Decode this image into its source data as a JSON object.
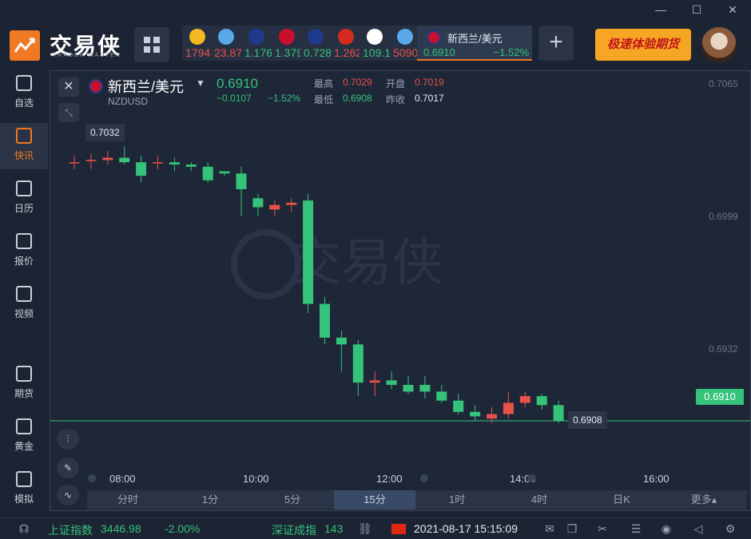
{
  "app": {
    "logo_text": "交易侠",
    "logo_sub": "TRADER MASTER",
    "window_controls": [
      "—",
      "☐",
      "✕"
    ]
  },
  "quotes": [
    {
      "icon": "gold-coin-icon",
      "value": "1794",
      "color": "#e8524a",
      "icon_color": "#f5b722"
    },
    {
      "icon": "silver-icon",
      "value": "23.87",
      "color": "#e8524a",
      "icon_color": "#5aa8e8"
    },
    {
      "icon": "eu-us-flag-icon",
      "value": "1.176",
      "color": "#35c27a",
      "icon_color": "#1f3a8a"
    },
    {
      "icon": "gb-us-flag-icon",
      "value": "1.379",
      "color": "#35c27a",
      "icon_color": "#c8102e"
    },
    {
      "icon": "au-us-flag-icon",
      "value": "0.728",
      "color": "#35c27a",
      "icon_color": "#1f3a8a"
    },
    {
      "icon": "ca-us-flag-icon",
      "value": "1.262",
      "color": "#e8524a",
      "icon_color": "#d52b1e"
    },
    {
      "icon": "jp-us-flag-icon",
      "value": "109.1",
      "color": "#35c27a",
      "icon_color": "#ffffff"
    },
    {
      "icon": "oil-icon",
      "value": "5090",
      "color": "#e8524a",
      "icon_color": "#5aa8e8"
    }
  ],
  "active_quote": {
    "name": "新西兰/美元",
    "price": "0.6910",
    "pct": "−1.52%"
  },
  "promo": "极速体验期货",
  "sidebar": [
    {
      "icon": "bookmark-icon",
      "label": "自选",
      "active": false
    },
    {
      "icon": "news-icon",
      "label": "快讯",
      "active": true
    },
    {
      "icon": "calendar-icon",
      "label": "日历",
      "active": false
    },
    {
      "icon": "price-chart-icon",
      "label": "报价",
      "active": false
    },
    {
      "icon": "video-play-icon",
      "label": "视频",
      "active": false
    },
    {
      "icon": "futures-icon",
      "label": "期货",
      "active": false
    },
    {
      "icon": "gold-icon",
      "label": "黄金",
      "active": false
    },
    {
      "icon": "simulate-icon",
      "label": "模拟",
      "active": false
    }
  ],
  "symbol": {
    "name": "新西兰/美元",
    "code": "NZDUSD",
    "price": "0.6910",
    "change": "−0.0107",
    "pct": "−1.52%",
    "high_label": "最高",
    "high": "0.7029",
    "low_label": "最低",
    "low": "0.6908",
    "open_label": "开盘",
    "open": "0.7019",
    "prev_label": "昨收",
    "prev": "0.7017"
  },
  "chart_tags": {
    "high": "0.7032",
    "low": "0.6908",
    "current": "0.6910"
  },
  "chart_data": {
    "type": "candlestick",
    "interval": "15分",
    "ylim": [
      0.6888,
      0.7062
    ],
    "y_ticks": [
      "0.7065",
      "0.6999",
      "0.6932"
    ],
    "x_ticks": [
      "08:00",
      "10:00",
      "12:00",
      "14:00",
      "16:00"
    ],
    "current_price": 0.691,
    "candles": [
      {
        "o": 0.7025,
        "h": 0.7028,
        "l": 0.7022,
        "c": 0.7025
      },
      {
        "o": 0.7026,
        "h": 0.7029,
        "l": 0.7022,
        "c": 0.7026
      },
      {
        "o": 0.7026,
        "h": 0.703,
        "l": 0.7024,
        "c": 0.7027
      },
      {
        "o": 0.7027,
        "h": 0.7032,
        "l": 0.7024,
        "c": 0.7025
      },
      {
        "o": 0.7025,
        "h": 0.7028,
        "l": 0.7016,
        "c": 0.7019
      },
      {
        "o": 0.7025,
        "h": 0.7028,
        "l": 0.7022,
        "c": 0.7025
      },
      {
        "o": 0.7025,
        "h": 0.7027,
        "l": 0.7021,
        "c": 0.7024
      },
      {
        "o": 0.7024,
        "h": 0.7025,
        "l": 0.7021,
        "c": 0.7023
      },
      {
        "o": 0.7023,
        "h": 0.7025,
        "l": 0.7016,
        "c": 0.7017
      },
      {
        "o": 0.7021,
        "h": 0.7021,
        "l": 0.7019,
        "c": 0.702
      },
      {
        "o": 0.702,
        "h": 0.7023,
        "l": 0.7001,
        "c": 0.7013
      },
      {
        "o": 0.7009,
        "h": 0.7011,
        "l": 0.7001,
        "c": 0.7005
      },
      {
        "o": 0.7004,
        "h": 0.7008,
        "l": 0.7001,
        "c": 0.7006
      },
      {
        "o": 0.7006,
        "h": 0.7009,
        "l": 0.7003,
        "c": 0.7007
      },
      {
        "o": 0.7008,
        "h": 0.7011,
        "l": 0.6958,
        "c": 0.6962
      },
      {
        "o": 0.6962,
        "h": 0.6965,
        "l": 0.6944,
        "c": 0.6947
      },
      {
        "o": 0.6947,
        "h": 0.695,
        "l": 0.6932,
        "c": 0.6944
      },
      {
        "o": 0.6944,
        "h": 0.6946,
        "l": 0.6921,
        "c": 0.6927
      },
      {
        "o": 0.6927,
        "h": 0.6932,
        "l": 0.6921,
        "c": 0.6928
      },
      {
        "o": 0.6928,
        "h": 0.6932,
        "l": 0.6924,
        "c": 0.6926
      },
      {
        "o": 0.6926,
        "h": 0.693,
        "l": 0.6922,
        "c": 0.6923
      },
      {
        "o": 0.6926,
        "h": 0.693,
        "l": 0.692,
        "c": 0.6923
      },
      {
        "o": 0.6923,
        "h": 0.6926,
        "l": 0.6918,
        "c": 0.6919
      },
      {
        "o": 0.6919,
        "h": 0.6922,
        "l": 0.6913,
        "c": 0.6914
      },
      {
        "o": 0.6914,
        "h": 0.6917,
        "l": 0.691,
        "c": 0.6912
      },
      {
        "o": 0.6911,
        "h": 0.6916,
        "l": 0.6909,
        "c": 0.6913
      },
      {
        "o": 0.6913,
        "h": 0.6923,
        "l": 0.6911,
        "c": 0.6918
      },
      {
        "o": 0.6918,
        "h": 0.6923,
        "l": 0.6916,
        "c": 0.6921
      },
      {
        "o": 0.6921,
        "h": 0.6922,
        "l": 0.6915,
        "c": 0.6917
      },
      {
        "o": 0.6917,
        "h": 0.6919,
        "l": 0.6909,
        "c": 0.691
      }
    ]
  },
  "periods": [
    {
      "label": "分时",
      "active": false
    },
    {
      "label": "1分",
      "active": false
    },
    {
      "label": "5分",
      "active": false
    },
    {
      "label": "15分",
      "active": true
    },
    {
      "label": "1时",
      "active": false
    },
    {
      "label": "4时",
      "active": false
    },
    {
      "label": "日K",
      "active": false
    },
    {
      "label": "更多▴",
      "active": false
    }
  ],
  "statusbar": {
    "index1_name": "上证指数",
    "index1_value": "3446.98",
    "index1_pct": "-2.00%",
    "index2_name": "深证成指",
    "index2_value": "143",
    "datetime": "2021-08-17 15:15:09"
  },
  "colors": {
    "up": "#e8524a",
    "down": "#35c27a",
    "accent": "#f07a24"
  }
}
